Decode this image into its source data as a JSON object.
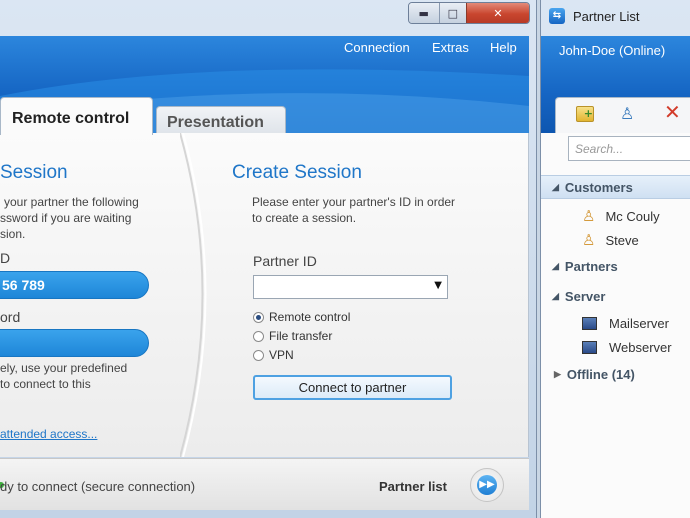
{
  "main_window": {
    "menu": [
      "Connection",
      "Extras",
      "Help"
    ],
    "tabs": {
      "remote_control": "Remote control",
      "presentation": "Presentation"
    },
    "allow": {
      "heading": "Session",
      "lines": [
        "your partner the following",
        "ssword if you are waiting",
        "sion."
      ],
      "id_label": "D",
      "id_value": "56 789",
      "password_label": "ord",
      "password_value": "",
      "predefined_lines": [
        "ely, use your predefined",
        "to connect to this"
      ],
      "unattended_link": "attended access..."
    },
    "create": {
      "heading": "Create Session",
      "description": [
        "Please enter your partner's ID in order",
        "to create a session."
      ],
      "partner_id_label": "Partner ID",
      "partner_id_value": "",
      "modes": [
        {
          "label": "Remote control",
          "selected": true
        },
        {
          "label": "File transfer",
          "selected": false
        },
        {
          "label": "VPN",
          "selected": false
        }
      ],
      "connect_button": "Connect to partner"
    },
    "status": {
      "text": "dy to connect (secure connection)",
      "partner_list_button": "Partner list",
      "status_color": "#3fb03f"
    }
  },
  "partner_list": {
    "title": "Partner List",
    "user": "John-Doe (Online)",
    "search_placeholder": "Search...",
    "groups": [
      {
        "name": "Customers",
        "expanded": true,
        "items": [
          {
            "name": "Mc Couly",
            "icon": "person-icon"
          },
          {
            "name": "Steve",
            "icon": "person-icon"
          }
        ]
      },
      {
        "name": "Partners",
        "expanded": true,
        "items": []
      },
      {
        "name": "Server",
        "expanded": true,
        "items": [
          {
            "name": "Mailserver",
            "icon": "computer-icon"
          },
          {
            "name": "Webserver",
            "icon": "computer-icon"
          }
        ]
      },
      {
        "name": "Offline (14)",
        "expanded": false,
        "items": []
      }
    ]
  },
  "colors": {
    "accent": "#1f76c8",
    "header_blue": "#1565c3",
    "close_red": "#c9462f"
  }
}
